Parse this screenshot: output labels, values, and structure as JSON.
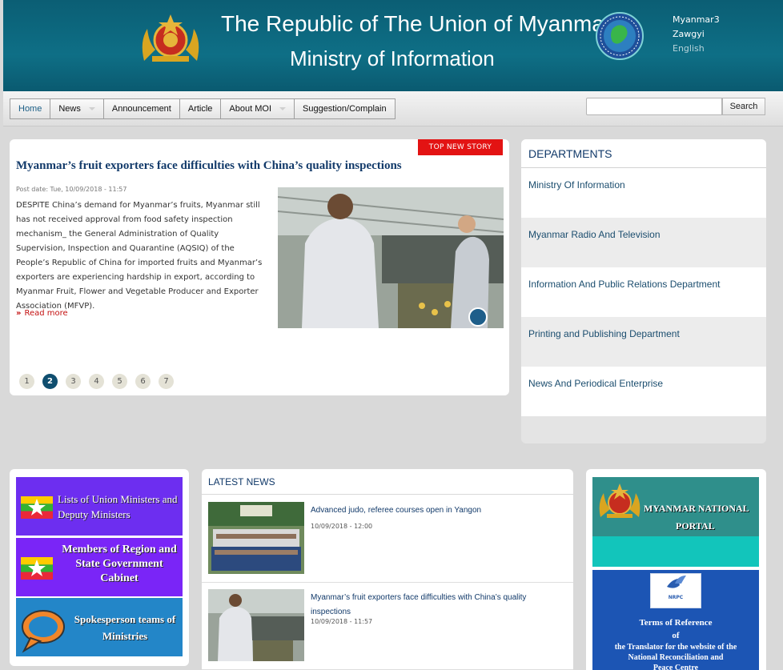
{
  "header": {
    "title_line1": "The Republic of The Union of Myanmar",
    "title_line2": "Ministry of Information",
    "languages": [
      "Myanmar3",
      "Zawgyi",
      "English"
    ],
    "colors": {
      "header_bg": "#0e6f86",
      "accent_text": "#123a6a"
    }
  },
  "nav": {
    "items": [
      {
        "label": "Home",
        "has_submenu": false
      },
      {
        "label": "News",
        "has_submenu": true
      },
      {
        "label": "Announcement",
        "has_submenu": false
      },
      {
        "label": "Article",
        "has_submenu": false
      },
      {
        "label": "About MOI",
        "has_submenu": true
      },
      {
        "label": "Suggestion/Complain",
        "has_submenu": false
      }
    ],
    "search_button": "Search",
    "search_value": ""
  },
  "featured": {
    "badge": "TOP NEW STORY",
    "title": "Myanmar’s fruit exporters face difficulties with China’s quality inspections",
    "post_date": "Post date: Tue, 10/09/2018 - 11:57",
    "body": "DESPITE China’s demand for Myanmar’s fruits, Myanmar still has not received approval from food safety inspection mechanism_ the General Administration of Quality Supervision, Inspection and Quarantine (AQSIQ) of the People’s Republic of China for imported fruits and Myanmar’s exporters are experiencing hardship in export, according to Myanmar Fruit, Flower and Vegetable Producer and Exporter Association (MFVP).",
    "read_more": "Read more",
    "pages": [
      "1",
      "2",
      "3",
      "4",
      "5",
      "6",
      "7"
    ],
    "active_page": "2"
  },
  "departments": {
    "heading": "DEPARTMENTS",
    "items": [
      "Ministry Of Information",
      "Myanmar Radio And Television",
      "Information And Public Relations Department",
      "Printing and Publishing Department",
      "News And Periodical Enterprise"
    ]
  },
  "links": {
    "ministers": "Lists of Union Ministers and Deputy Ministers",
    "region_cabinet": "Members of Region and State Government Cabinet",
    "spokesperson": "Spokesperson teams of Ministries"
  },
  "latest_news": {
    "heading": "LATEST NEWS",
    "items": [
      {
        "title": "Advanced judo, referee courses open in Yangon",
        "date": "10/09/2018 - 12:00"
      },
      {
        "title": "Myanmar’s fruit exporters face difficulties with China’s quality inspections",
        "date": "10/09/2018 - 11:57"
      }
    ]
  },
  "banners": {
    "portal_line1": "MYANMAR NATIONAL",
    "portal_line2": "PORTAL",
    "nrpc_logo": "NRPC",
    "nrpc_line1": "Terms of Reference",
    "nrpc_line2": "of",
    "nrpc_line3": "the Translator for the website of the",
    "nrpc_line4": "National Reconciliation and",
    "nrpc_line5": "Peace Centre"
  }
}
